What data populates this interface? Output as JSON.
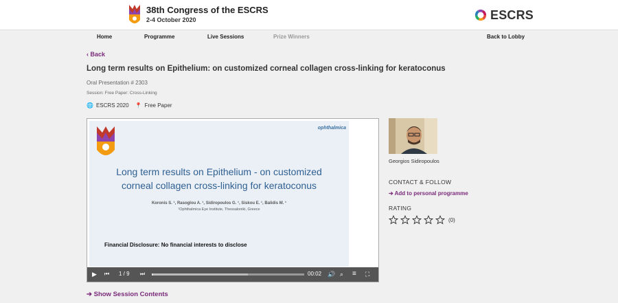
{
  "header": {
    "congress_title": "38th Congress of the ESCRS",
    "congress_dates": "2-4 October 2020",
    "brand": "ESCRS"
  },
  "nav": {
    "home": "Home",
    "programme": "Programme",
    "live_sessions": "Live Sessions",
    "prize_winners": "Prize Winners",
    "back_to_lobby": "Back to Lobby"
  },
  "page": {
    "back": "Back",
    "title": "Long term results on Epithelium: on customized corneal collagen cross-linking for keratoconus",
    "presentation_number": "Oral Presentation # 2303",
    "session": "Session: Free Paper: Cross-Linking",
    "tags": [
      "ESCRS 2020",
      "Free Paper"
    ],
    "show_session_contents": "Show Session Contents"
  },
  "slide": {
    "sponsor": "ophthalmica",
    "title_line1": "Long term results on Epithelium - on customized",
    "title_line2": "corneal collagen cross-linking for keratoconus",
    "authors": "Koronis S. ¹, Rasoglou A. ¹, Sidiropoulos G. ¹, Siskou E. ¹, Balidis M. ¹",
    "institution": "¹Ophthalmica Eye Institute, Thessaloniki, Greece",
    "disclosure": "Financial Disclosure: No financial interests to disclose"
  },
  "player": {
    "page_counter": "1 / 9",
    "time": "00:02",
    "progress_fraction": 0.01,
    "buffered_fraction": 0.63
  },
  "speaker": {
    "name": "Georgios Sidiropoulos",
    "contact_heading": "CONTACT & FOLLOW",
    "add_programme": "Add to personal programme",
    "rating_heading": "RATING",
    "rating_count": "(0)",
    "rating_value": 0,
    "rating_max": 5
  },
  "colors": {
    "accent_purple": "#7a2a7a",
    "slide_title_blue": "#2f5f93",
    "player_bar": "#555555"
  },
  "icons": {
    "tag_globe": "globe-icon",
    "tag_pin": "pin-icon",
    "play": "play-icon",
    "volume": "volume-icon",
    "fullscreen": "fullscreen-icon"
  }
}
